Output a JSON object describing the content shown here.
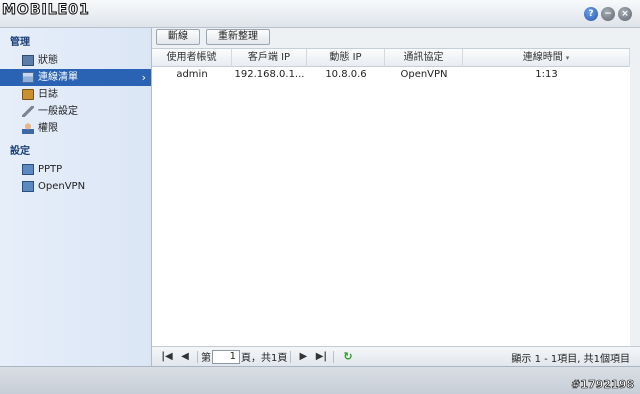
{
  "logo_text": "MOBILE01",
  "window_buttons": {
    "help": "?",
    "minimize": "−",
    "close": "×"
  },
  "sidebar": {
    "manage_title": "管理",
    "manage_items": [
      {
        "label": "狀態",
        "icon": "monitor-icon"
      },
      {
        "label": "連線清單",
        "icon": "list-icon",
        "active": true
      },
      {
        "label": "日誌",
        "icon": "book-icon"
      },
      {
        "label": "一般設定",
        "icon": "wrench-icon"
      },
      {
        "label": "權限",
        "icon": "user-icon"
      }
    ],
    "settings_title": "設定",
    "settings_items": [
      {
        "label": "PPTP",
        "icon": "network-icon"
      },
      {
        "label": "OpenVPN",
        "icon": "network-icon"
      }
    ],
    "active_arrow": "›"
  },
  "toolbar": {
    "disconnect_label": "斷線",
    "refresh_label": "重新整理"
  },
  "table": {
    "columns": [
      "使用者帳號",
      "客戶端 IP",
      "動態 IP",
      "通訊協定",
      "連線時間"
    ],
    "sort_indicator": "▾",
    "rows": [
      [
        "admin",
        "192.168.0.1...",
        "10.8.0.6",
        "OpenVPN",
        "1:13"
      ]
    ]
  },
  "pager": {
    "first": "|◀",
    "prev": "◀",
    "page_prefix": "第",
    "page_value": "1",
    "page_suffix": "頁，共1頁",
    "next": "▶",
    "last": "▶|",
    "refresh": "↻",
    "info": "顯示 1 - 1項目, 共1個項目"
  },
  "watermark": "#1792198",
  "colors": {
    "accent": "#2a63b4",
    "refresh_green": "#2f9a2a"
  }
}
